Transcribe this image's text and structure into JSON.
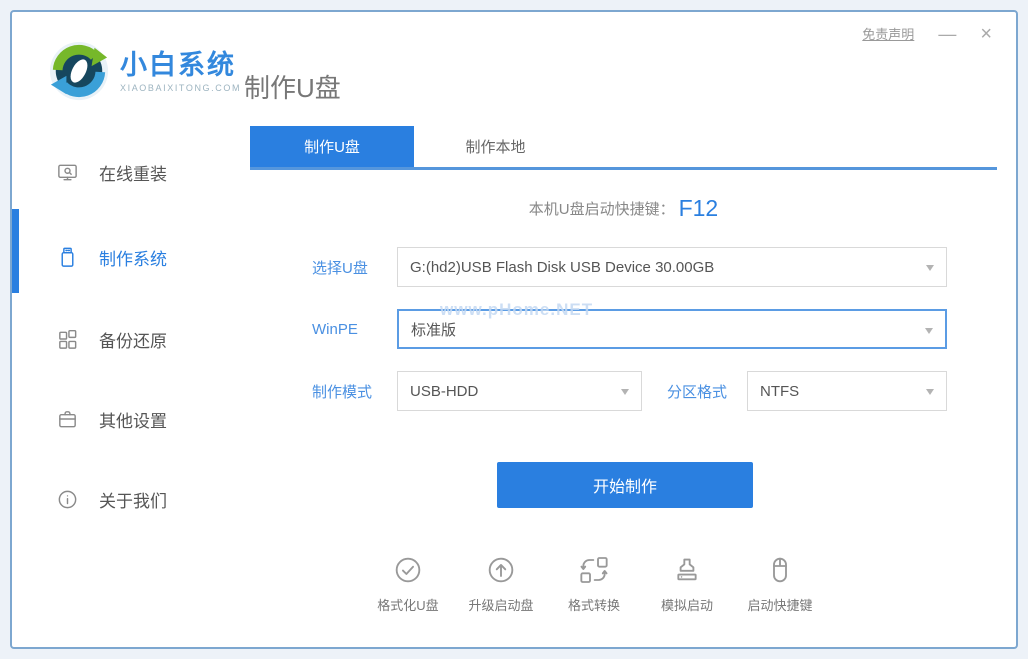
{
  "window": {
    "disclaimer": "免责声明",
    "minimize": "—",
    "close": "×"
  },
  "brand": {
    "name": "小白系统",
    "domain": "XIAOBAIXITONG.COM",
    "logo": "recycle-arrows-logo"
  },
  "header": {
    "title": "制作U盘"
  },
  "sidebar": {
    "items": [
      {
        "label": "在线重装",
        "icon": "monitor-icon",
        "active": false
      },
      {
        "label": "制作系统",
        "icon": "usb-drive-icon",
        "active": true
      },
      {
        "label": "备份还原",
        "icon": "blocks-icon",
        "active": false
      },
      {
        "label": "其他设置",
        "icon": "briefcase-icon",
        "active": false
      },
      {
        "label": "关于我们",
        "icon": "info-icon",
        "active": false
      }
    ]
  },
  "tabs": [
    {
      "label": "制作U盘",
      "active": true
    },
    {
      "label": "制作本地",
      "active": false
    }
  ],
  "hotkey": {
    "prefix": "本机U盘启动快捷键：",
    "key": "F12"
  },
  "form": {
    "usb": {
      "label": "选择U盘",
      "value": "G:(hd2)USB Flash Disk USB Device 30.00GB"
    },
    "winpe": {
      "label": "WinPE",
      "value": "标准版"
    },
    "mode": {
      "label": "制作模式",
      "value": "USB-HDD"
    },
    "partition": {
      "label": "分区格式",
      "value": "NTFS"
    }
  },
  "watermark": "www.pHome.NET",
  "actions": {
    "start": "开始制作"
  },
  "footer": {
    "items": [
      {
        "label": "格式化U盘",
        "icon": "check-circle-icon"
      },
      {
        "label": "升级启动盘",
        "icon": "arrow-up-circle-icon"
      },
      {
        "label": "格式转换",
        "icon": "convert-icon"
      },
      {
        "label": "模拟启动",
        "icon": "stamp-icon"
      },
      {
        "label": "启动快捷键",
        "icon": "mouse-icon"
      }
    ]
  },
  "colors": {
    "primary": "#2a7fe0",
    "label_blue": "#4a90e2",
    "window_border": "#7da7d0",
    "tab_underline": "#5596dc"
  }
}
